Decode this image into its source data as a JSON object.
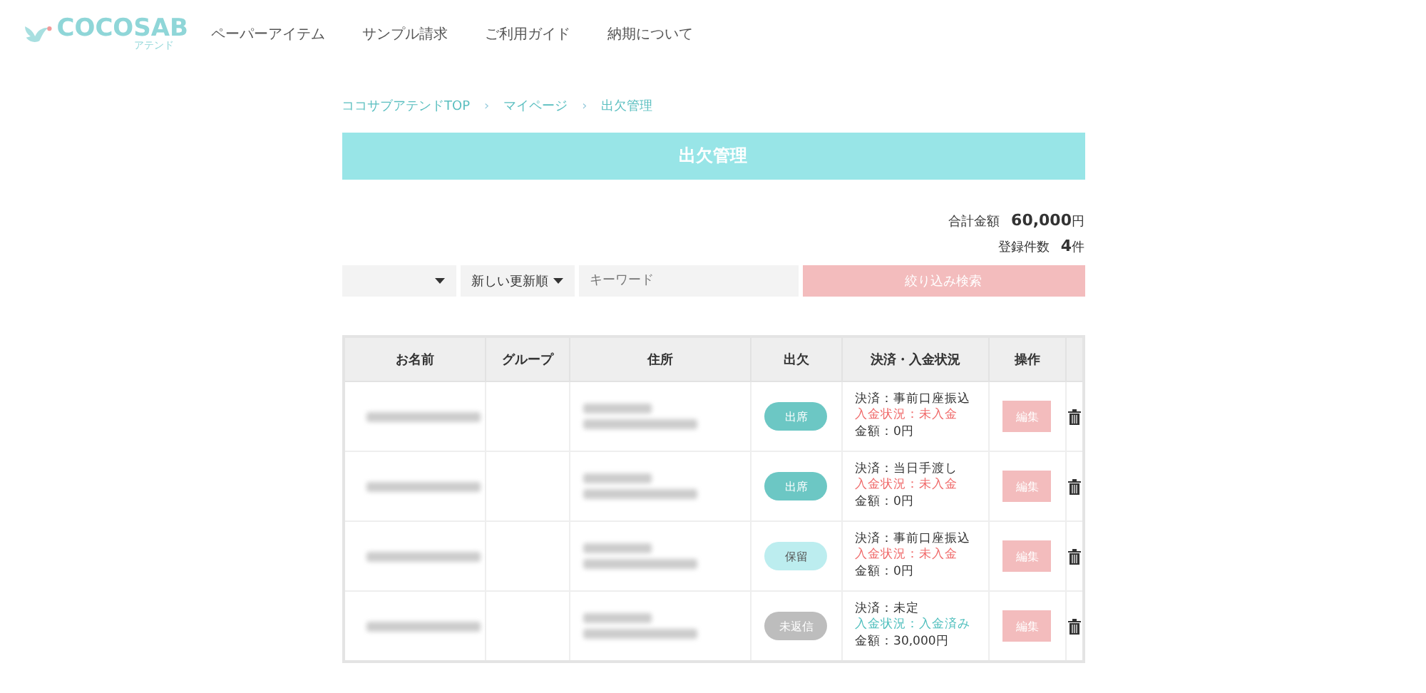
{
  "header": {
    "logo": {
      "text": "COCOSAB",
      "subtext": "アテンド"
    },
    "nav": [
      "ペーパーアイテム",
      "サンプル請求",
      "ご利用ガイド",
      "納期について"
    ]
  },
  "breadcrumb": {
    "items": [
      "ココサブアテンドTOP",
      "マイページ",
      "出欠管理"
    ],
    "separators": [
      "›",
      "›"
    ]
  },
  "banner": {
    "title": "出欠管理"
  },
  "summary": [
    {
      "label": "合計金額",
      "value": "60,000",
      "unit": "円"
    },
    {
      "label": "登録件数",
      "value": "4",
      "unit": "件"
    }
  ],
  "filters": {
    "select_2": {
      "value": "新しい更新順"
    },
    "keyword": {
      "placeholder": "キーワード"
    },
    "search_button": "絞り込み検索"
  },
  "table": {
    "columns": [
      "お名前",
      "グループ",
      "住所",
      "出欠",
      "決済・入金状況",
      "操作"
    ],
    "rows": [
      {
        "name_blurred": true,
        "address_blurred": true,
        "attendance": {
          "kind": "attending",
          "label": "出席"
        },
        "payment": "決済：事前口座振込",
        "deposit": {
          "text": "入金状況：未入金",
          "paid": false
        },
        "amount": "金額：0円",
        "edit": "編集"
      },
      {
        "name_blurred": true,
        "address_blurred": true,
        "attendance": {
          "kind": "attending",
          "label": "出席"
        },
        "payment": "決済：当日手渡し",
        "deposit": {
          "text": "入金状況：未入金",
          "paid": false
        },
        "amount": "金額：0円",
        "edit": "編集"
      },
      {
        "name_blurred": true,
        "address_blurred": true,
        "attendance": {
          "kind": "pending",
          "label": "保留"
        },
        "payment": "決済：事前口座振込",
        "deposit": {
          "text": "入金状況：未入金",
          "paid": false
        },
        "amount": "金額：0円",
        "edit": "編集"
      },
      {
        "name_blurred": true,
        "address_blurred": true,
        "attendance": {
          "kind": "unanswered",
          "label": "未返信"
        },
        "payment": "決済：未定",
        "deposit": {
          "text": "入金状況：入金済み",
          "paid": true
        },
        "amount": "金額：30,000円",
        "edit": "編集"
      }
    ]
  }
}
